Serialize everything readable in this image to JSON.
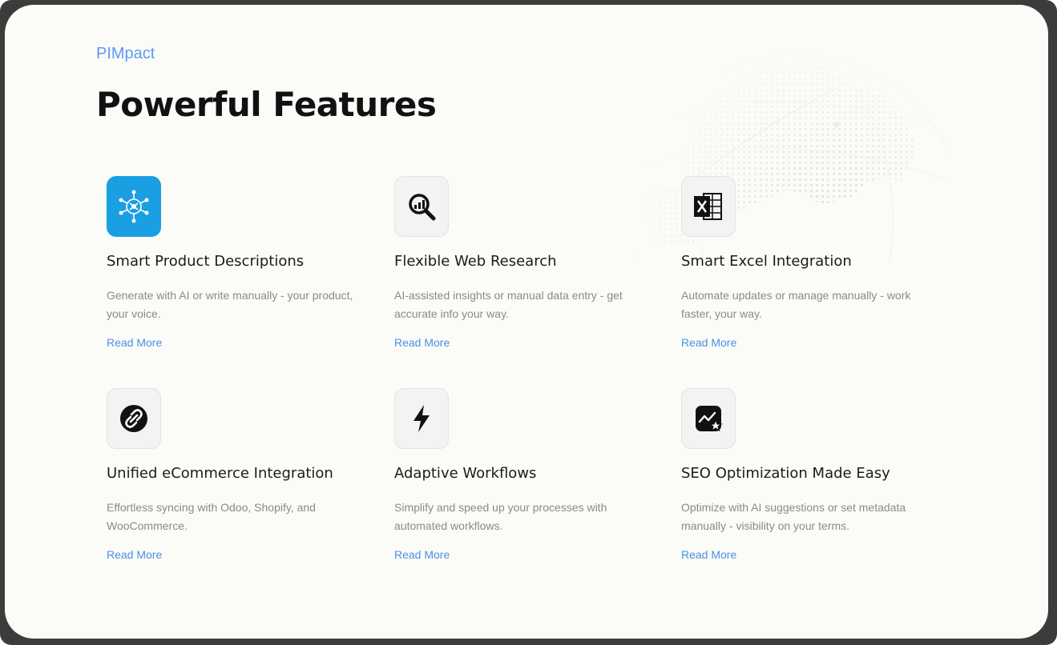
{
  "brand": "PIMpact",
  "heading": "Powerful Features",
  "features": [
    {
      "title": "Smart Product Descriptions",
      "description": "Generate with AI or write manually - your product, your voice.",
      "link": "Read More",
      "icon": "ai-network-icon"
    },
    {
      "title": "Flexible Web Research",
      "description": "AI-assisted insights or manual data entry - get accurate info your way.",
      "link": "Read More",
      "icon": "magnifier-chart-icon"
    },
    {
      "title": "Smart Excel Integration",
      "description": "Automate updates or manage manually - work faster, your way.",
      "link": "Read More",
      "icon": "excel-icon"
    },
    {
      "title": "Unified eCommerce Integration",
      "description": "Effortless syncing with Odoo, Shopify, and WooCommerce.",
      "link": "Read More",
      "icon": "link-circle-icon"
    },
    {
      "title": "Adaptive Workflows",
      "description": "Simplify and speed up your processes with automated workflows.",
      "link": "Read More",
      "icon": "lightning-icon"
    },
    {
      "title": "SEO Optimization Made Easy",
      "description": "Optimize with AI suggestions or set metadata manually - visibility on your terms.",
      "link": "Read More",
      "icon": "seo-chart-star-icon"
    }
  ],
  "colors": {
    "accent": "#4c8fe3",
    "brand": "#5b9bf0",
    "icon_blue": "#1a9fe3",
    "background": "#fbfcf8"
  }
}
